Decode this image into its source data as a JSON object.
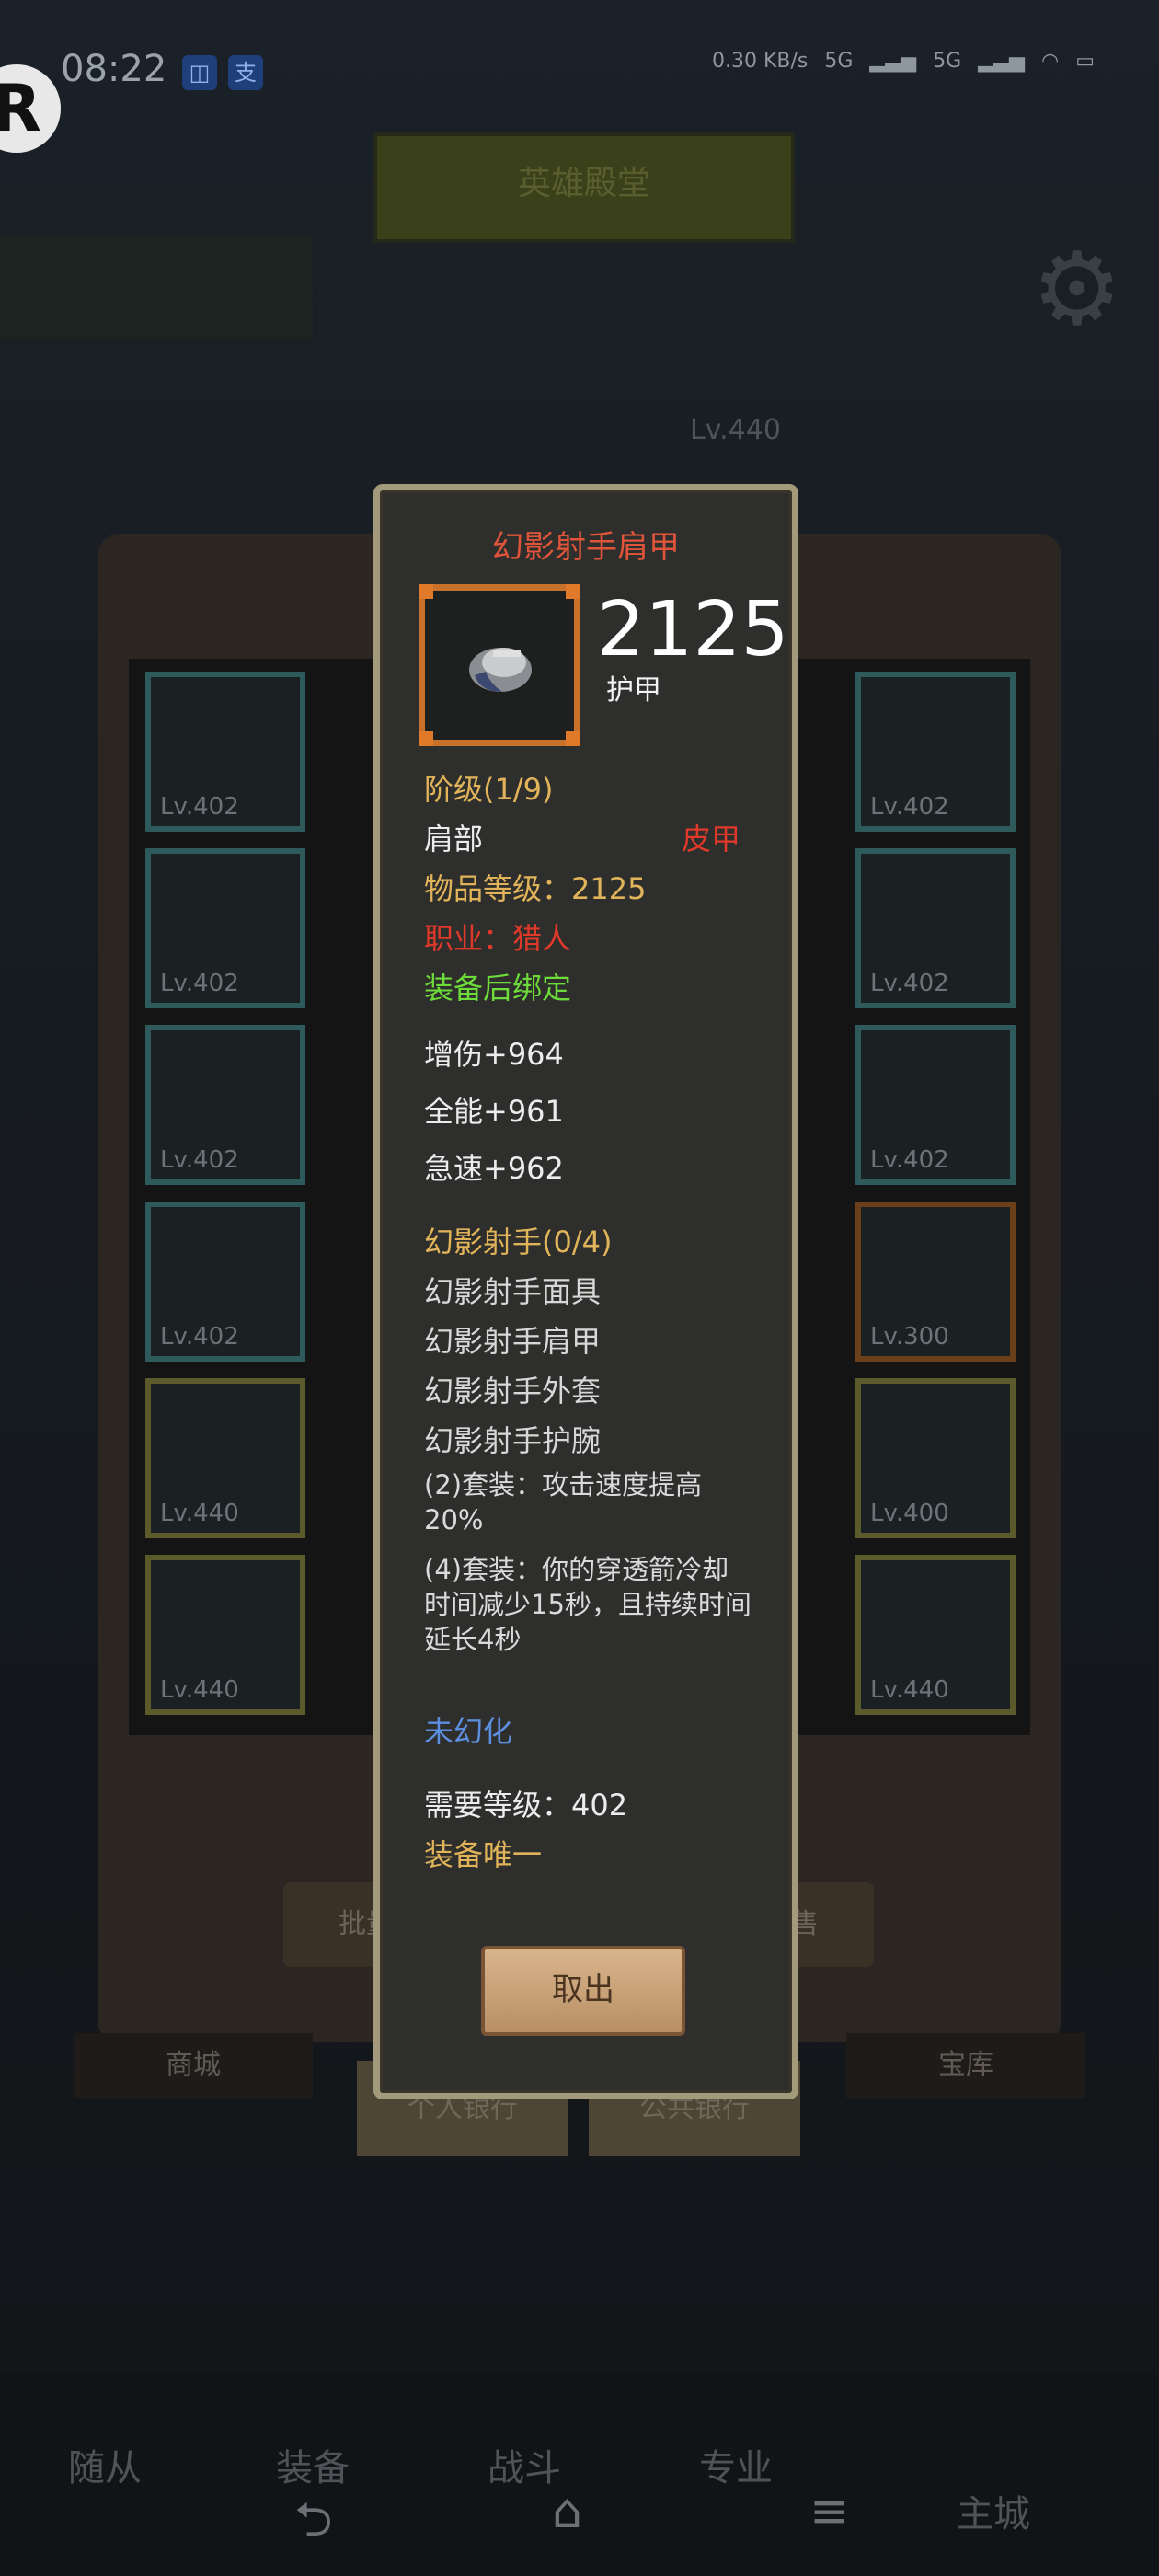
{
  "status_bar": {
    "time": "08:22",
    "speed": "0.30 KB/s",
    "network_1": "5G",
    "network_2": "5G"
  },
  "background": {
    "top_button": "英雄殿堂",
    "right_label": "Lv.440",
    "slot_levels": [
      "Lv.402",
      "Lv.402",
      "Lv.402",
      "Lv.402",
      "Lv.402",
      "Lv.402",
      "Lv.402",
      "Lv.300",
      "Lv.440",
      "Lv.400",
      "Lv.440",
      "Lv.440"
    ],
    "batch_button": "批量",
    "sell_button": "出售",
    "tab_mall": "商城",
    "tab_vault": "宝库",
    "personal_bank": "个人银行",
    "public_bank": "公共银行",
    "nav": [
      "随从",
      "装备",
      "战斗",
      "专业",
      "主城"
    ]
  },
  "item": {
    "name": "幻影射手肩甲",
    "stat_value": "2125",
    "stat_label": "护甲",
    "tier": "阶级(1/9)",
    "slot": "肩部",
    "armor_type": "皮甲",
    "item_level": "物品等级：2125",
    "class_req": "职业：猎人",
    "bind": "装备后绑定",
    "stats": [
      "增伤+964",
      "全能+961",
      "急速+962"
    ],
    "set_name": "幻影射手(0/4)",
    "set_pieces": [
      "幻影射手面具",
      "幻影射手肩甲",
      "幻影射手外套",
      "幻影射手护腕"
    ],
    "set_bonus_2": "(2)套装：攻击速度提高20%",
    "set_bonus_4": "(4)套装：你的穿透箭冷却时间减少15秒，且持续时间延长4秒",
    "transmog": "未幻化",
    "required_level": "需要等级：402",
    "unique": "装备唯一",
    "take_out_button": "取出"
  },
  "colors": {
    "title": "#e0553a",
    "gold": "#e1b45a",
    "red": "#e0392a",
    "green": "#6ddc3a",
    "blue": "#5d8fe0",
    "card_border": "#a39a7c"
  }
}
